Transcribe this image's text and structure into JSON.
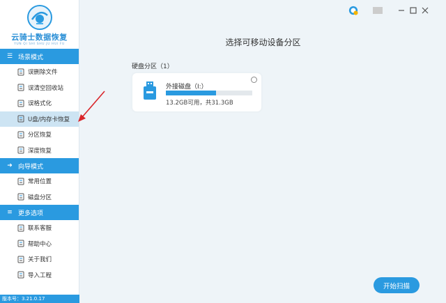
{
  "app": {
    "title": "云骑士数据恢复",
    "subtitle": "YUN QI SHI SHU JU HUI FU",
    "version": "版本号：3.21.0.17"
  },
  "sidebar": {
    "sections": [
      {
        "label": "场景模式",
        "items": [
          {
            "label": "误删除文件",
            "icon": "trash-file-icon"
          },
          {
            "label": "误清空回收站",
            "icon": "recycle-bin-icon"
          },
          {
            "label": "误格式化",
            "icon": "format-icon"
          },
          {
            "label": "U盘/内存卡恢复",
            "icon": "usb-card-icon",
            "active": true
          },
          {
            "label": "分区恢复",
            "icon": "partition-icon"
          },
          {
            "label": "深度恢复",
            "icon": "deep-scan-icon"
          }
        ]
      },
      {
        "label": "向导模式",
        "items": [
          {
            "label": "常用位置",
            "icon": "location-icon"
          },
          {
            "label": "磁盘分区",
            "icon": "disk-icon"
          }
        ]
      },
      {
        "label": "更多选项",
        "items": [
          {
            "label": "联系客服",
            "icon": "phone-icon"
          },
          {
            "label": "帮助中心",
            "icon": "help-icon"
          },
          {
            "label": "关于我们",
            "icon": "info-icon"
          },
          {
            "label": "导入工程",
            "icon": "import-icon"
          }
        ]
      }
    ]
  },
  "main": {
    "title": "选择可移动设备分区",
    "group_label": "硬盘分区（1）",
    "drive": {
      "name": "外接磁盘（I:）",
      "info": "13.2GB可用，共31.3GB",
      "used_fraction": 0.58
    },
    "scan_button": "开始扫描"
  },
  "colors": {
    "accent": "#2a9ae0",
    "active_bg": "#cde4f3",
    "arrow": "#d9262b"
  }
}
